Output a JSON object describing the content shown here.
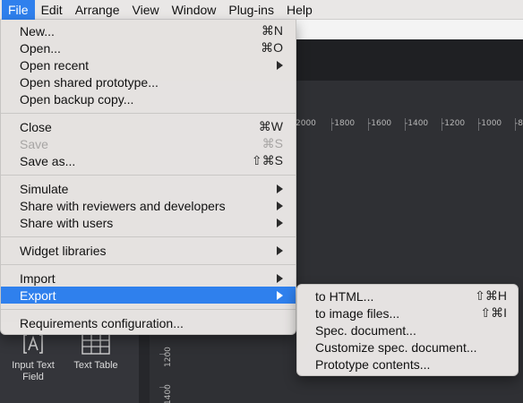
{
  "menubar": {
    "items": [
      {
        "label": "File",
        "active": true
      },
      {
        "label": "Edit"
      },
      {
        "label": "Arrange"
      },
      {
        "label": "View"
      },
      {
        "label": "Window"
      },
      {
        "label": "Plug-ins"
      },
      {
        "label": "Help"
      }
    ]
  },
  "file_menu": {
    "new": {
      "label": "New...",
      "shortcut": "⌘N"
    },
    "open": {
      "label": "Open...",
      "shortcut": "⌘O"
    },
    "open_recent": {
      "label": "Open recent"
    },
    "open_shared": {
      "label": "Open shared prototype..."
    },
    "open_backup": {
      "label": "Open backup copy..."
    },
    "close": {
      "label": "Close",
      "shortcut": "⌘W"
    },
    "save": {
      "label": "Save",
      "shortcut": "⌘S",
      "disabled": true
    },
    "save_as": {
      "label": "Save as...",
      "shortcut": "⇧⌘S"
    },
    "simulate": {
      "label": "Simulate"
    },
    "share_reviewers": {
      "label": "Share with reviewers and developers"
    },
    "share_users": {
      "label": "Share with users"
    },
    "widget_libraries": {
      "label": "Widget libraries"
    },
    "import": {
      "label": "Import"
    },
    "export": {
      "label": "Export",
      "highlighted": true
    },
    "requirements": {
      "label": "Requirements configuration..."
    }
  },
  "export_submenu": {
    "to_html": {
      "label": "to HTML...",
      "shortcut": "⇧⌘H"
    },
    "to_image": {
      "label": "to image files...",
      "shortcut": "⇧⌘I"
    },
    "spec_doc": {
      "label": "Spec. document..."
    },
    "customize_spec": {
      "label": "Customize spec. document..."
    },
    "prototype_contents": {
      "label": "Prototype contents..."
    }
  },
  "ruler_top": {
    "ticks": [
      "2000",
      "-1800",
      "-1600",
      "-1400",
      "-1200",
      "-1000",
      "-8"
    ]
  },
  "ruler_left": {
    "ticks": [
      "1200",
      "1400"
    ]
  },
  "widgets": {
    "input_text_field": {
      "label": "Input Text\nField"
    },
    "text_table": {
      "label": "Text Table"
    }
  },
  "colors": {
    "highlight": "#2f80ed",
    "menu_bg": "#e9e6e4",
    "canvas_bg": "#2f3034"
  }
}
